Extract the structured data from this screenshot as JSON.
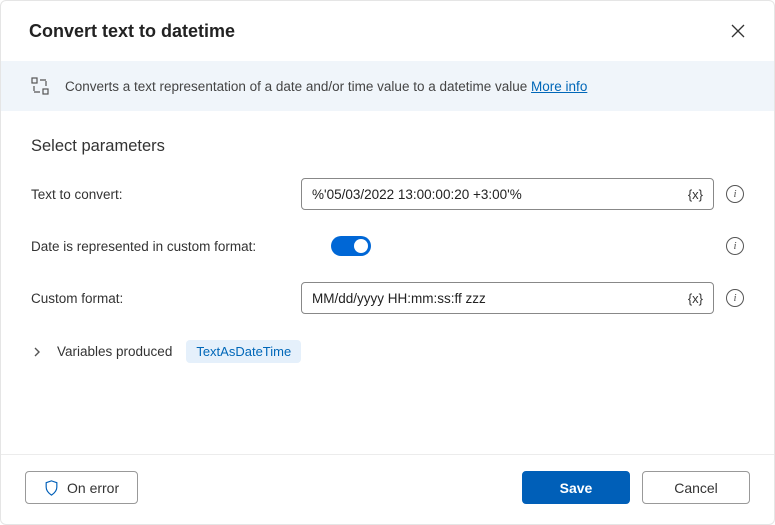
{
  "dialog": {
    "title": "Convert text to datetime",
    "description": "Converts a text representation of a date and/or time value to a datetime value",
    "more_info": "More info"
  },
  "parameters": {
    "heading": "Select parameters",
    "text_to_convert": {
      "label": "Text to convert:",
      "value": "%'05/03/2022 13:00:00:20 +3:00'%"
    },
    "custom_format_toggle": {
      "label": "Date is represented in custom format:",
      "on": true
    },
    "custom_format": {
      "label": "Custom format:",
      "value": "MM/dd/yyyy HH:mm:ss:ff zzz"
    },
    "variables_produced": {
      "label": "Variables produced",
      "chip": "TextAsDateTime"
    }
  },
  "glyphs": {
    "var_insert": "{x}"
  },
  "footer": {
    "on_error": "On error",
    "save": "Save",
    "cancel": "Cancel"
  }
}
